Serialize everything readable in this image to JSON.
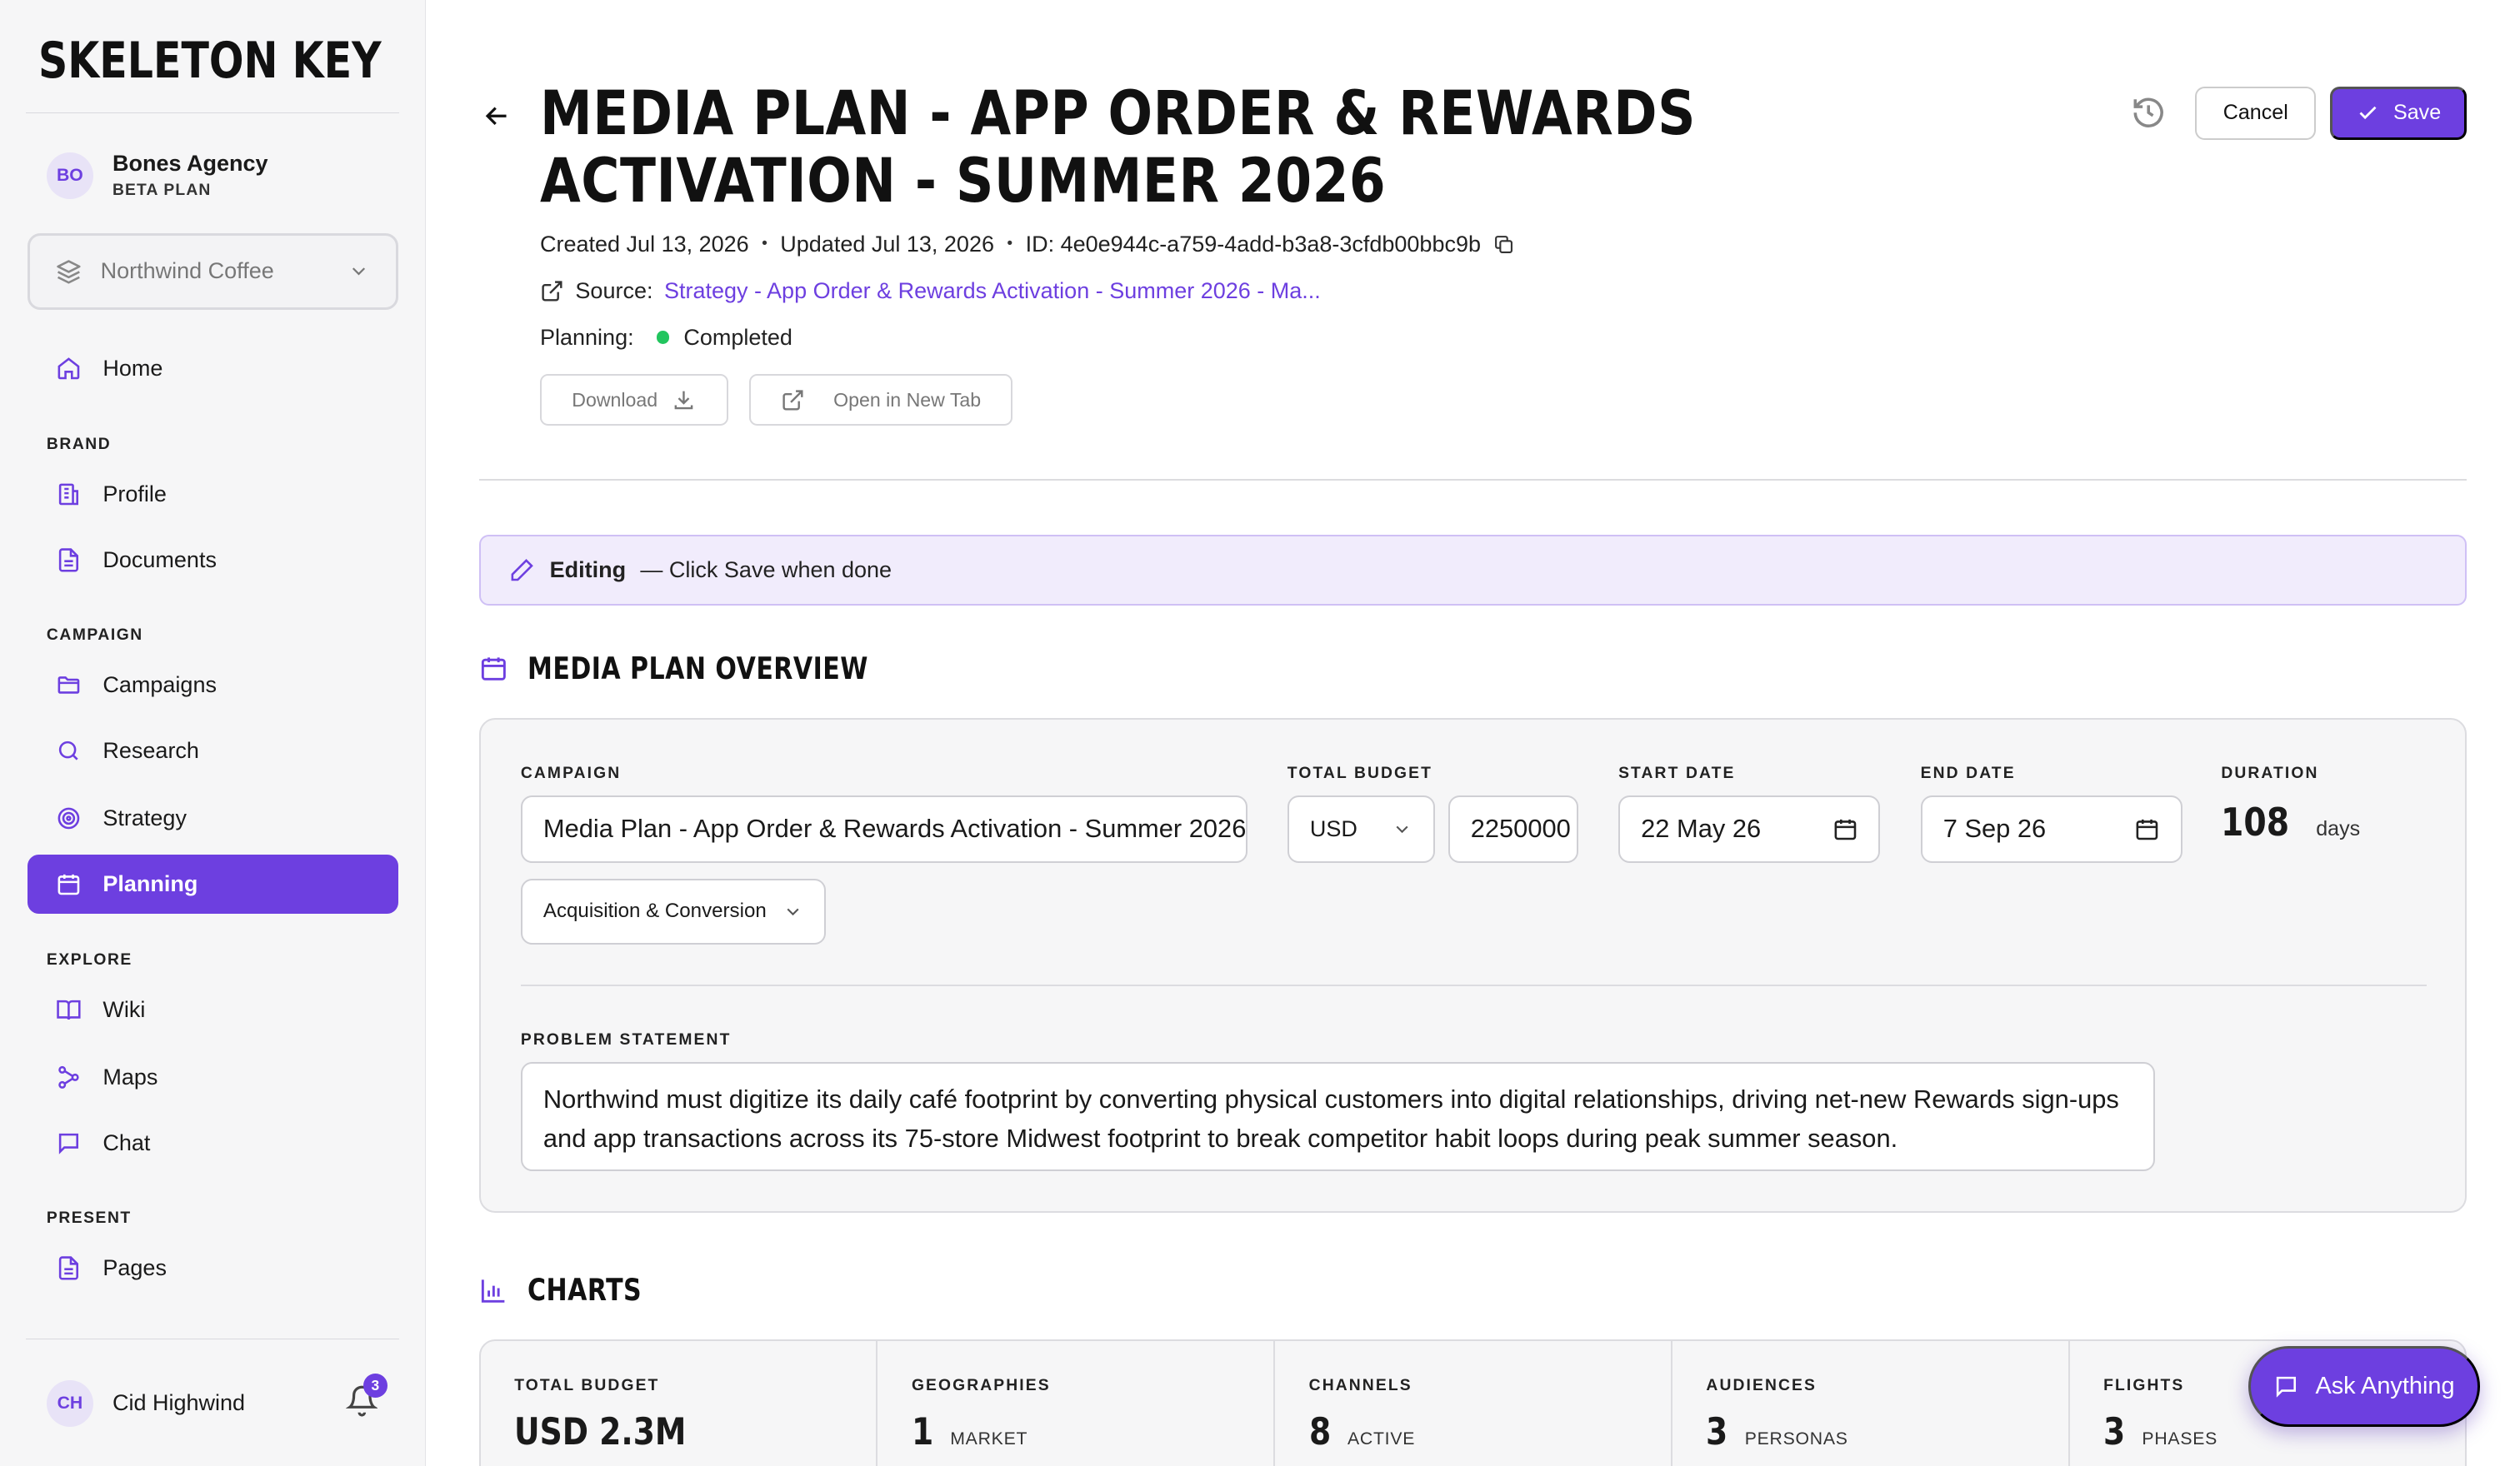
{
  "app": {
    "logo": "SKELETON KEY"
  },
  "agency": {
    "initials": "BO",
    "name": "Bones Agency",
    "plan": "BETA PLAN"
  },
  "brand_selector": {
    "value": "Northwind Coffee"
  },
  "nav": {
    "home": "Home",
    "brand_section": "BRAND",
    "profile": "Profile",
    "documents": "Documents",
    "campaign_section": "CAMPAIGN",
    "campaigns": "Campaigns",
    "research": "Research",
    "strategy": "Strategy",
    "planning": "Planning",
    "explore_section": "EXPLORE",
    "wiki": "Wiki",
    "maps": "Maps",
    "chat": "Chat",
    "present_section": "PRESENT",
    "pages": "Pages"
  },
  "user": {
    "initials": "CH",
    "name": "Cid Highwind",
    "notification_count": "3"
  },
  "header": {
    "title": "MEDIA PLAN - APP ORDER & REWARDS ACTIVATION - SUMMER 2026",
    "cancel_label": "Cancel",
    "save_label": "Save",
    "created": "Created Jul 13, 2026",
    "updated": "Updated Jul 13, 2026",
    "id": "ID: 4e0e944c-a759-4add-b3a8-3cfdb00bbc9b",
    "source_label": "Source:",
    "source_link": "Strategy - App Order & Rewards Activation - Summer 2026 - Ma...",
    "planning_label": "Planning:",
    "planning_status": "Completed",
    "download_label": "Download",
    "open_tab_label": "Open in New Tab"
  },
  "editing_bar": {
    "label": "Editing",
    "hint": "— Click Save when done"
  },
  "overview": {
    "title": "MEDIA PLAN OVERVIEW",
    "campaign_label": "CAMPAIGN",
    "campaign_value": "Media Plan - App Order & Rewards Activation - Summer 2026",
    "budget_label": "TOTAL BUDGET",
    "currency": "USD",
    "budget_value": "2250000",
    "start_label": "START DATE",
    "start_value": "22 May 26",
    "end_label": "END DATE",
    "end_value": "7 Sep 26",
    "duration_label": "DURATION",
    "duration_value": "108",
    "duration_unit": "days",
    "objective": "Acquisition & Conversion",
    "problem_label": "PROBLEM STATEMENT",
    "problem_text": "Northwind must digitize its daily café footprint by converting physical customers into digital relationships, driving net-new Rewards sign-ups and app transactions across its 75-store Midwest footprint to break competitor habit loops during peak summer season."
  },
  "charts": {
    "title": "CHARTS",
    "stats": [
      {
        "label": "TOTAL BUDGET",
        "value": "USD 2.3M",
        "unit": ""
      },
      {
        "label": "GEOGRAPHIES",
        "value": "1",
        "unit": "MARKET"
      },
      {
        "label": "CHANNELS",
        "value": "8",
        "unit": "ACTIVE"
      },
      {
        "label": "AUDIENCES",
        "value": "3",
        "unit": "PERSONAS"
      },
      {
        "label": "FLIGHTS",
        "value": "3",
        "unit": "PHASES"
      }
    ]
  },
  "ask": {
    "label": "Ask Anything"
  },
  "colors": {
    "accent": "#6d3fe0",
    "status_completed": "#22c55e"
  }
}
